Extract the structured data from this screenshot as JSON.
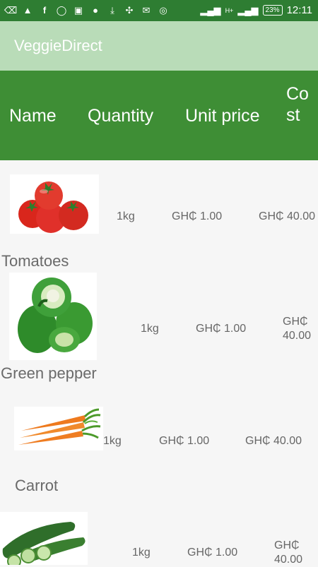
{
  "status_bar": {
    "time": "12:11",
    "battery": "23%",
    "network": "H+"
  },
  "app": {
    "title": "VeggieDirect"
  },
  "table": {
    "headers": {
      "name": "Name",
      "quantity": "Quantity",
      "unit_price": "Unit price",
      "cost": "Cost"
    },
    "rows": [
      {
        "name": "Tomatoes",
        "quantity": "1kg",
        "unit_price": "GH₵ 1.00",
        "cost": "GH₵ 40.00"
      },
      {
        "name": "Green pepper",
        "quantity": "1kg",
        "unit_price": "GH₵ 1.00",
        "cost": "GH₵ 40.00"
      },
      {
        "name": "Carrot",
        "quantity": "1kg",
        "unit_price": "GH₵ 1.00",
        "cost": "GH₵ 40.00"
      },
      {
        "name": "",
        "quantity": "1kg",
        "unit_price": "GH₵ 1.00",
        "cost": "GH₵ 40.00"
      }
    ]
  },
  "colors": {
    "status_bar": "#2e7d32",
    "app_bar": "#b9dcb8",
    "table_header": "#3e8e35",
    "background": "#f6f6f6"
  }
}
